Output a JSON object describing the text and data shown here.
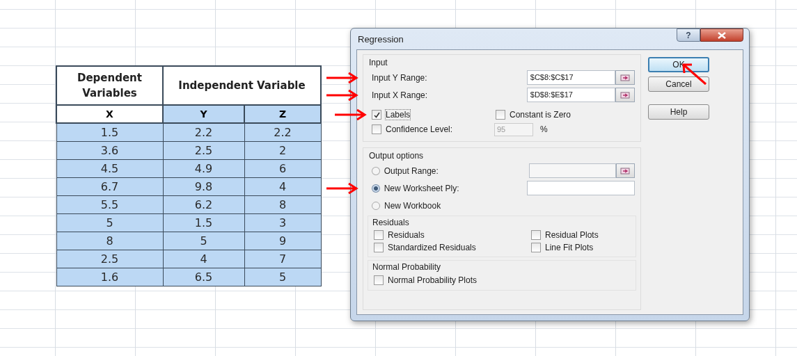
{
  "sheet": {
    "table": {
      "header_groups": [
        {
          "label": "Dependent Variables"
        },
        {
          "label": "Independent Variable"
        }
      ],
      "columns": [
        {
          "label": "X",
          "highlighted": false
        },
        {
          "label": "Y",
          "highlighted": true
        },
        {
          "label": "Z",
          "highlighted": true
        }
      ],
      "rows": [
        [
          "1.5",
          "2.2",
          "2.2"
        ],
        [
          "3.6",
          "2.5",
          "2"
        ],
        [
          "4.5",
          "4.9",
          "6"
        ],
        [
          "6.7",
          "9.8",
          "4"
        ],
        [
          "5.5",
          "6.2",
          "8"
        ],
        [
          "5",
          "1.5",
          "3"
        ],
        [
          "8",
          "5",
          "9"
        ],
        [
          "2.5",
          "4",
          "7"
        ],
        [
          "1.6",
          "6.5",
          "5"
        ]
      ]
    }
  },
  "dialog": {
    "title": "Regression",
    "help_button": "?",
    "input": {
      "title": "Input",
      "ranges": [
        {
          "label": "Input Y Range:",
          "value": "$C$8:$C$17",
          "annotated": true
        },
        {
          "label": "Input X Range:",
          "value": "$D$8:$E$17",
          "annotated": true
        }
      ],
      "options": [
        {
          "label": "Labels",
          "checked": true,
          "annotated": true
        },
        {
          "label": "Constant is Zero",
          "checked": false,
          "annotated": false
        }
      ],
      "confidence": {
        "label": "Confidence Level:",
        "checked": false,
        "value": "95",
        "unit": "%"
      }
    },
    "output": {
      "title": "Output options",
      "choices": [
        {
          "label": "Output Range:",
          "selected": false,
          "kind": "picker",
          "annotated": false
        },
        {
          "label": "New Worksheet Ply:",
          "selected": true,
          "kind": "plain",
          "annotated": true
        },
        {
          "label": "New Workbook",
          "selected": false,
          "kind": "bare",
          "annotated": false
        }
      ]
    },
    "residuals": {
      "title": "Residuals",
      "options": [
        {
          "label": "Residuals",
          "checked": false
        },
        {
          "label": "Residual Plots",
          "checked": false
        },
        {
          "label": "Standardized Residuals",
          "checked": false
        },
        {
          "label": "Line Fit Plots",
          "checked": false
        }
      ]
    },
    "normal": {
      "title": "Normal Probability",
      "options": [
        {
          "label": "Normal Probability Plots",
          "checked": false
        }
      ]
    },
    "buttons": [
      {
        "label": "OK",
        "default": true,
        "annotated": true
      },
      {
        "label": "Cancel",
        "default": false,
        "annotated": false
      },
      {
        "label": "Help",
        "default": false,
        "annotated": false
      }
    ]
  }
}
